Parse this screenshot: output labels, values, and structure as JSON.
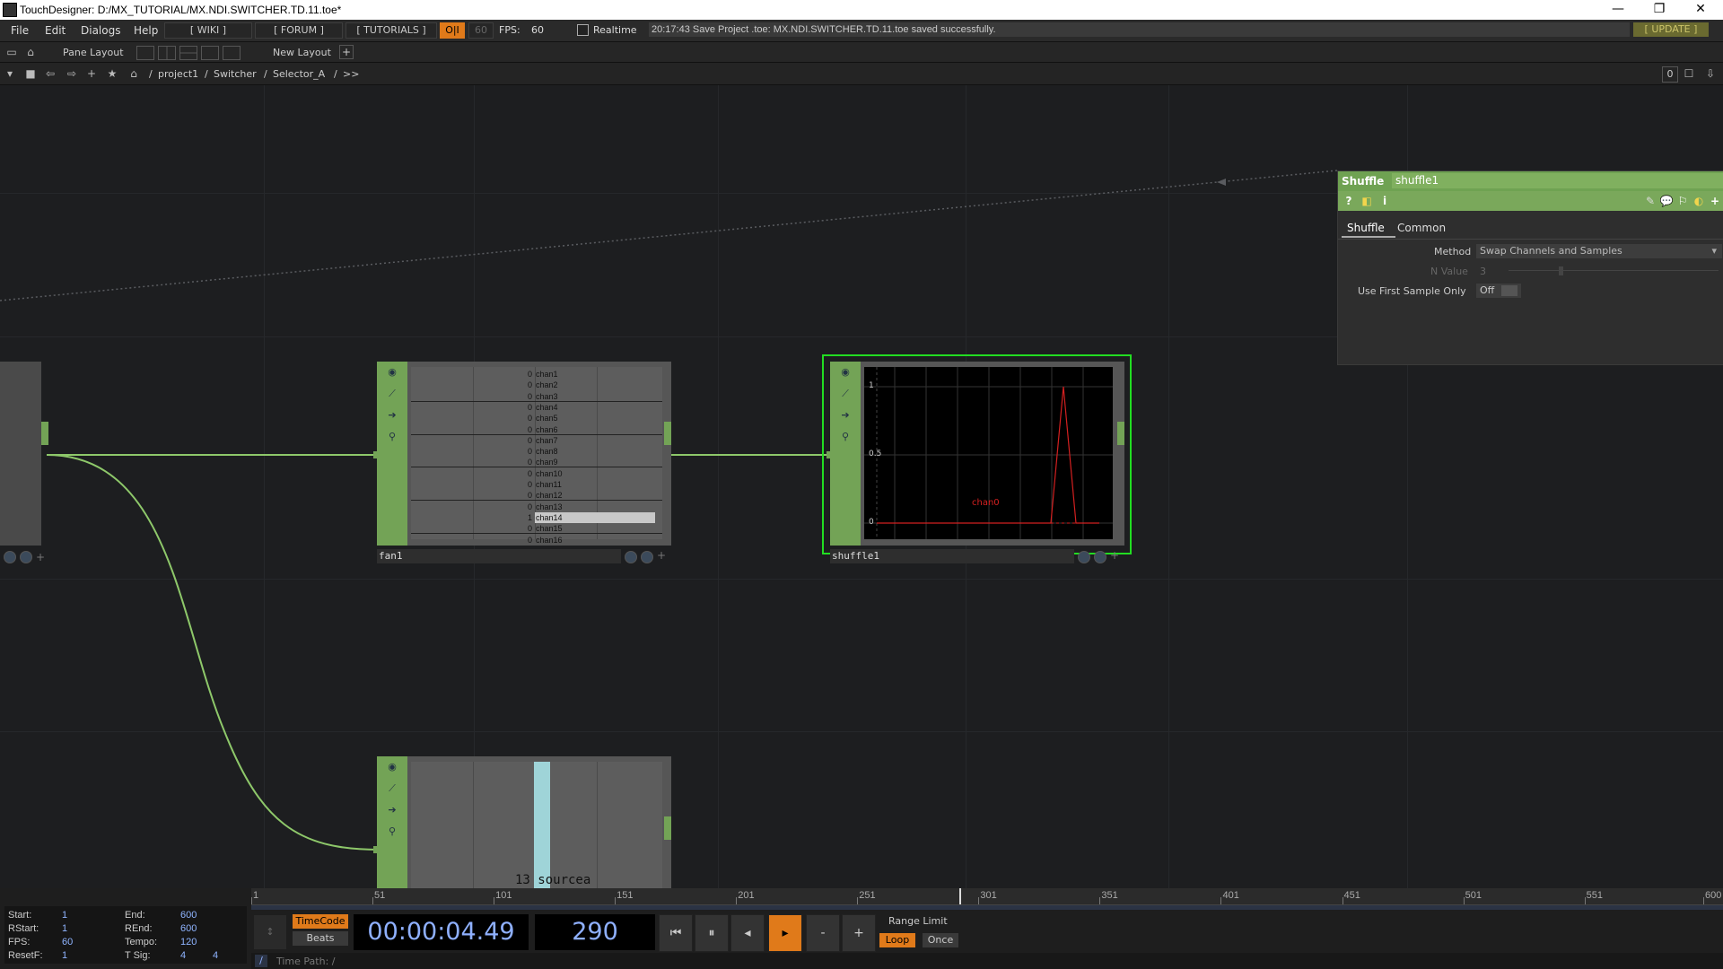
{
  "window": {
    "title": "TouchDesigner: D:/MX_TUTORIAL/MX.NDI.SWITCHER.TD.11.toe*",
    "minimize": "—",
    "restore": "❐",
    "close": "✕"
  },
  "menu": {
    "items": [
      "File",
      "Edit",
      "Dialogs",
      "Help"
    ],
    "wiki": "[ WIKI ]",
    "forum": "[ FORUM ]",
    "tutorials": "[ TUTORIALS ]",
    "oi": "O|I",
    "fps_cap": "60",
    "fps_label": "FPS:",
    "fps_value": "60",
    "realtime": "Realtime",
    "status": "20:17:43 Save Project .toe: MX.NDI.SWITCHER.TD.11.toe saved successfully.",
    "update": "[ UPDATE ]"
  },
  "toolbar": {
    "pane_layout": "Pane Layout",
    "new_layout": "New Layout",
    "plus": "+"
  },
  "path": {
    "segments": [
      "/",
      "project1",
      "/",
      "Switcher",
      "/",
      "Selector_A",
      "/",
      ">>"
    ],
    "right_value": "0"
  },
  "nodes": {
    "fan1": {
      "name": "fan1",
      "channels": [
        {
          "v": "0",
          "n": "chan1"
        },
        {
          "v": "0",
          "n": "chan2"
        },
        {
          "v": "0",
          "n": "chan3"
        },
        {
          "v": "0",
          "n": "chan4"
        },
        {
          "v": "0",
          "n": "chan5"
        },
        {
          "v": "0",
          "n": "chan6"
        },
        {
          "v": "0",
          "n": "chan7"
        },
        {
          "v": "0",
          "n": "chan8"
        },
        {
          "v": "0",
          "n": "chan9"
        },
        {
          "v": "0",
          "n": "chan10"
        },
        {
          "v": "0",
          "n": "chan11"
        },
        {
          "v": "0",
          "n": "chan12"
        },
        {
          "v": "0",
          "n": "chan13"
        },
        {
          "v": "1",
          "n": "chan14"
        },
        {
          "v": "0",
          "n": "chan15"
        },
        {
          "v": "0",
          "n": "chan16"
        }
      ]
    },
    "shuffle1": {
      "name": "shuffle1",
      "ytick_1": "1",
      "ytick_05": "0.5",
      "ytick_0": "0",
      "series": "chan0"
    },
    "source": {
      "label": "13 sourcea"
    }
  },
  "params": {
    "op_type": "Shuffle",
    "op_name": "shuffle1",
    "tabs": [
      "Shuffle",
      "Common"
    ],
    "method_label": "Method",
    "method_value": "Swap Channels and Samples",
    "nvalue_label": "N Value",
    "nvalue_value": "3",
    "firstsample_label": "Use First Sample Only",
    "firstsample_value": "Off"
  },
  "timeline": {
    "ticks": [
      "1",
      "51",
      "101",
      "151",
      "201",
      "251",
      "301",
      "351",
      "401",
      "451",
      "501",
      "551",
      "600"
    ],
    "start_label": "Start:",
    "start": "1",
    "end_label": "End:",
    "end": "600",
    "rstart_label": "RStart:",
    "rstart": "1",
    "rend_label": "REnd:",
    "rend": "600",
    "fps_label": "FPS:",
    "fps": "60",
    "tempo_label": "Tempo:",
    "tempo": "120",
    "resetf_label": "ResetF:",
    "resetf": "1",
    "tsig_label": "T Sig:",
    "tsig_a": "4",
    "tsig_b": "4",
    "timecode_btn": "TimeCode",
    "beats_btn": "Beats",
    "timecode": "00:00:04.49",
    "frame": "290",
    "range_limit": "Range Limit",
    "loop": "Loop",
    "once": "Once",
    "time_path_label": "Time Path: /",
    "minus": "-",
    "plus": "+"
  },
  "colors": {
    "op_green": "#73a356",
    "select_green": "#22dd22",
    "accent_orange": "#e07a1a",
    "value_blue": "#8fb0ff"
  }
}
